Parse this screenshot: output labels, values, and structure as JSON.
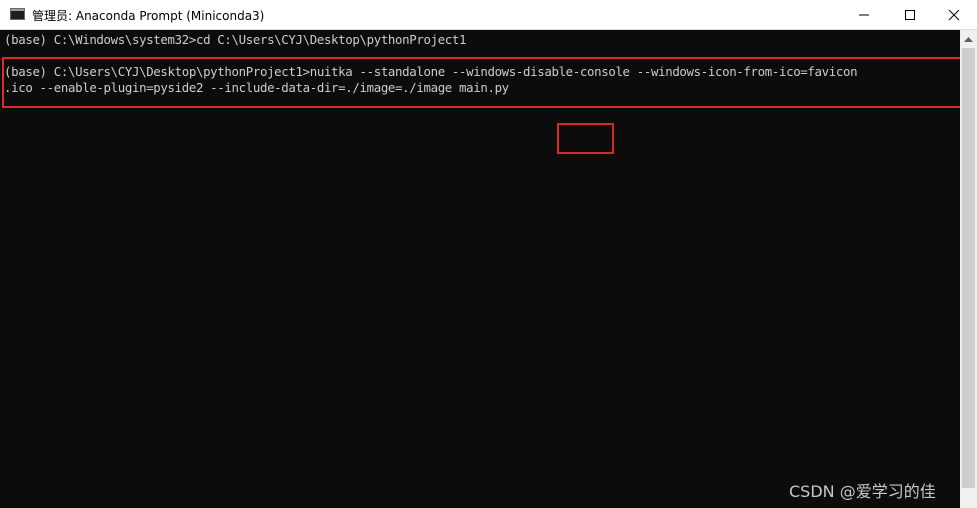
{
  "window": {
    "title": "管理员: Anaconda Prompt (Miniconda3)",
    "icon": "console-icon",
    "controls": {
      "minimize": "minimize-icon",
      "maximize": "maximize-icon",
      "close": "close-icon"
    }
  },
  "console": {
    "background": "#0c0c0c",
    "text_color": "#cccccc",
    "lines": [
      "(base) C:\\Windows\\system32>cd C:\\Users\\CYJ\\Desktop\\pythonProject1",
      "(base) C:\\Users\\CYJ\\Desktop\\pythonProject1>nuitka --standalone --windows-disable-console --windows-icon-from-ico=favicon",
      ".ico --enable-plugin=pyside2 --include-data-dir=./image=./image main.py"
    ]
  },
  "annotations": {
    "highlight_color": "#e0292b"
  },
  "watermark": "CSDN @爱学习的佳"
}
